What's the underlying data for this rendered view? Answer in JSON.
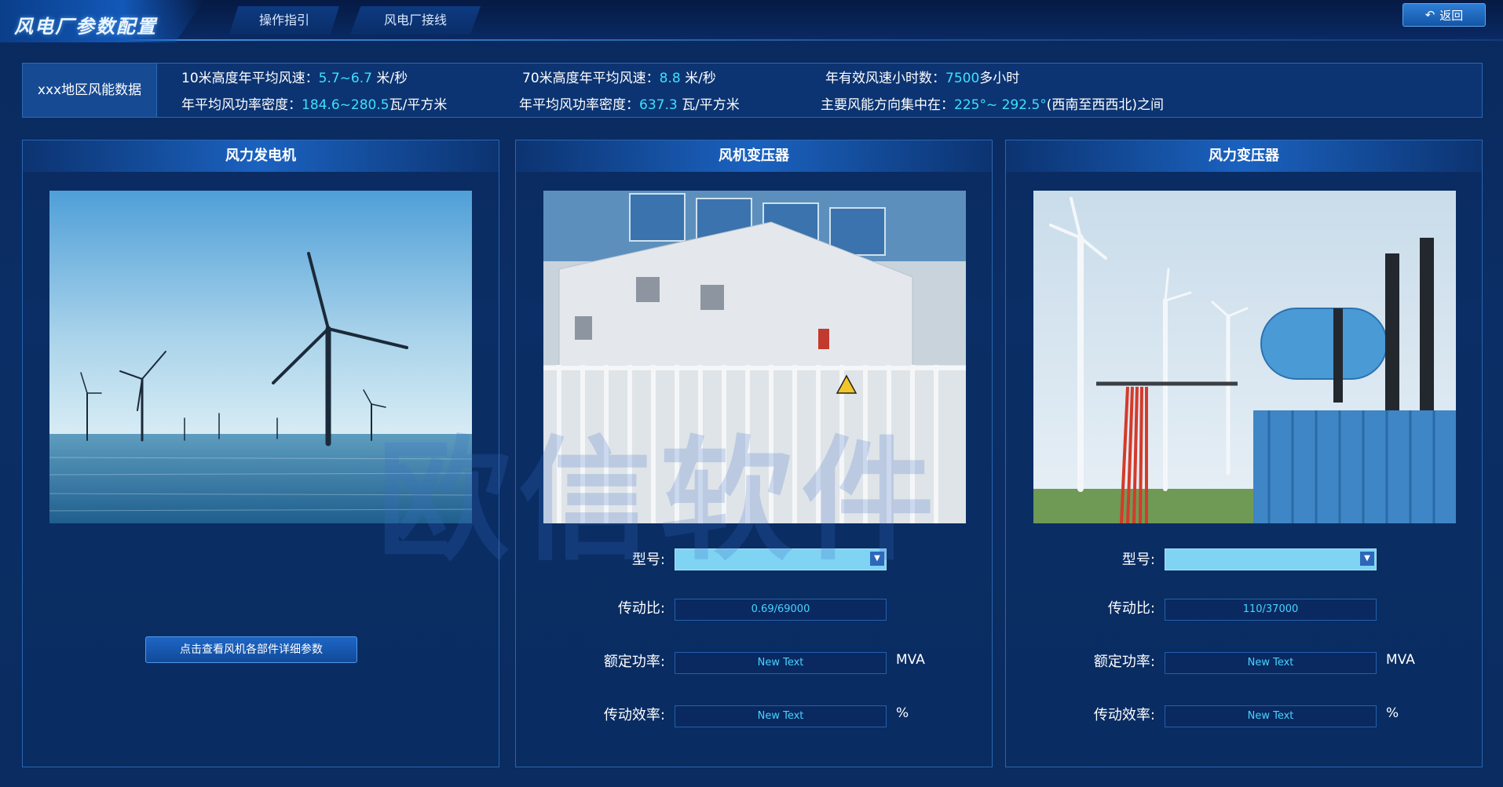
{
  "header": {
    "title": "风电厂参数配置",
    "tabs": [
      {
        "label": "操作指引"
      },
      {
        "label": "风电厂接线"
      }
    ],
    "back_label": "返回"
  },
  "info": {
    "region_label": "xxx地区风能数据",
    "rows": [
      [
        {
          "label": "10米高度年平均风速：",
          "value": "5.7~6.7",
          "unit": " 米/秒"
        },
        {
          "label": "70米高度年平均风速：",
          "value": "8.8",
          "unit": " 米/秒"
        },
        {
          "label": "年有效风速小时数：",
          "value": "7500",
          "unit": "多小时"
        }
      ],
      [
        {
          "label": "年平均风功率密度：",
          "value": "184.6~280.5",
          "unit": "瓦/平方米"
        },
        {
          "label": "年平均风功率密度：",
          "value": "637.3",
          "unit": " 瓦/平方米"
        },
        {
          "label": "主要风能方向集中在：",
          "value": "225°~ 292.5°",
          "unit": "(西南至西西北)之间"
        }
      ]
    ]
  },
  "panels": [
    {
      "title": "风力发电机",
      "detail_button": "点击查看风机各部件详细参数"
    },
    {
      "title": "风机变压器",
      "fields": {
        "model_label": "型号:",
        "model_value": "",
        "ratio_label": "传动比:",
        "ratio_value": "0.69/69000",
        "power_label": "额定功率:",
        "power_value": "New Text",
        "power_unit": "MVA",
        "eff_label": "传动效率:",
        "eff_value": "New Text",
        "eff_unit": "%"
      }
    },
    {
      "title": "风力变压器",
      "fields": {
        "model_label": "型号:",
        "model_value": "",
        "ratio_label": "传动比:",
        "ratio_value": "110/37000",
        "power_label": "额定功率:",
        "power_value": "New Text",
        "power_unit": "MVA",
        "eff_label": "传动效率:",
        "eff_value": "New Text",
        "eff_unit": "%"
      }
    }
  ],
  "watermark": "欧信软件",
  "icons": {
    "back": "back-arrow-icon",
    "dropdown": "chevron-down-icon"
  },
  "colors": {
    "accent": "#3ee0ff",
    "background": "#0b2e66",
    "panel_border": "#2a66b0"
  }
}
